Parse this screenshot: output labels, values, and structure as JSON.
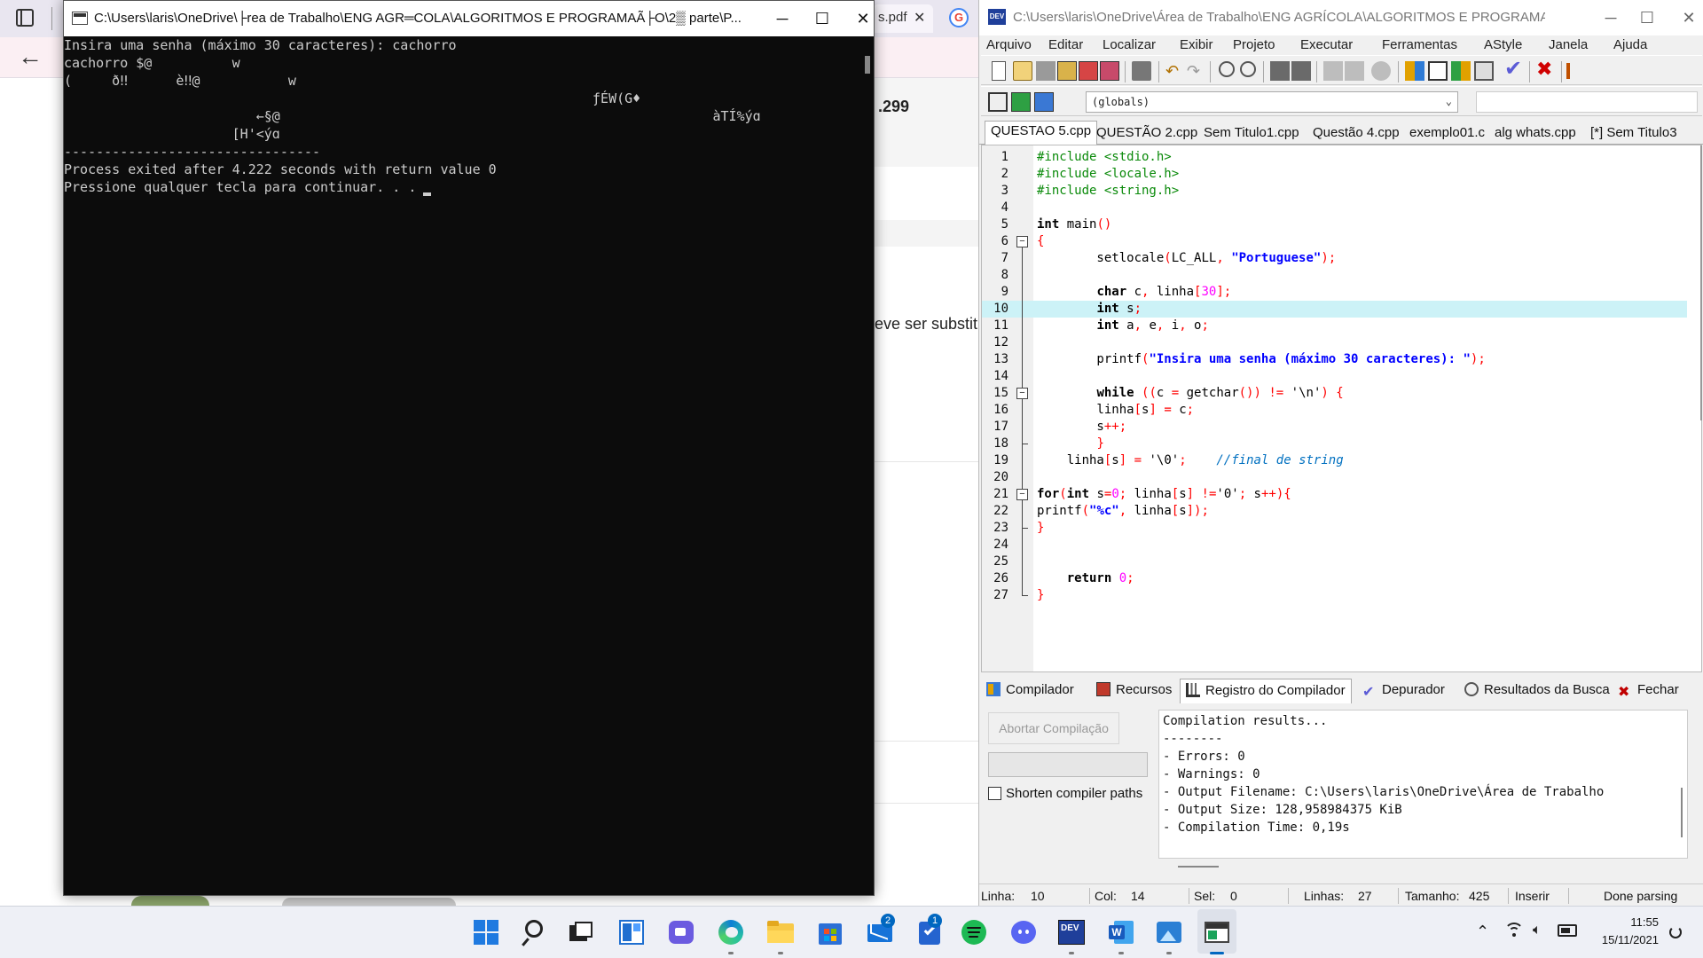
{
  "browser": {
    "tab_label": "s.pdf",
    "tab_close": "✕",
    "google_icon": "G",
    "back_icon": "←",
    "content_number": ".299",
    "content_text": "eve ser substitu"
  },
  "console": {
    "title": "C:\\Users\\laris\\OneDrive\\├rea de Trabalho\\ENG AGR═COLA\\ALGORITMOS E PROGRAMAÃ├O\\2▒ parte\\P...",
    "minimize": "─",
    "maximize": "☐",
    "close": "✕",
    "lines": [
      "Insira uma senha (máximo 30 caracteres): cachorro",
      "cachorro $@          w",
      "(     ð‼      è‼@           w",
      "                                                                  ƒÉW(G♦",
      "                        ←§@                                                      àTÍ%ýɑ",
      "                     [H'<ýɑ",
      "--------------------------------",
      "Process exited after 4.222 seconds with return value 0",
      "Pressione qualquer tecla para continuar. . . "
    ]
  },
  "devcpp": {
    "title": "C:\\Users\\laris\\OneDrive\\Área de Trabalho\\ENG AGRÍCOLA\\ALGORITMOS E PROGRAMAÇ...",
    "logo": "DEV",
    "minimize": "─",
    "maximize": "☐",
    "close": "✕",
    "menu": [
      "Arquivo",
      "Editar",
      "Localizar",
      "Exibir",
      "Projeto",
      "Executar",
      "Ferramentas",
      "AStyle",
      "Janela",
      "Ajuda"
    ],
    "globals": "(globals)",
    "file_tabs": [
      "QUESTAO 5.cpp",
      "QUESTÃO 2.cpp",
      "Sem Titulo1.cpp",
      "Questão 4.cpp",
      "exemplo01.c",
      "alg whats.cpp",
      "[*] Sem Titulo3"
    ],
    "code_lines": [
      "1",
      "2",
      "3",
      "4",
      "5",
      "6",
      "7",
      "8",
      "9",
      "10",
      "11",
      "12",
      "13",
      "14",
      "15",
      "16",
      "17",
      "18",
      "19",
      "20",
      "21",
      "22",
      "23",
      "24",
      "25",
      "26",
      "27"
    ],
    "bottom_tabs": [
      "Compilador",
      "Recursos",
      "Registro do Compilador",
      "Depurador",
      "Resultados da Busca",
      "Fechar"
    ],
    "abort_button": "Abortar Compilação",
    "shorten_label": "Shorten compiler paths",
    "log_lines": [
      "Compilation results...",
      "--------",
      "- Errors: 0",
      "- Warnings: 0",
      "- Output Filename: C:\\Users\\laris\\OneDrive\\Área de Trabalho",
      "- Output Size: 128,958984375 KiB",
      "- Compilation Time: 0,19s"
    ],
    "status": {
      "linha_label": "Linha:",
      "linha": "10",
      "col_label": "Col:",
      "col": "14",
      "sel_label": "Sel:",
      "sel": "0",
      "linhas_label": "Linhas:",
      "linhas": "27",
      "tamanho_label": "Tamanho:",
      "tamanho": "425",
      "mode": "Inserir",
      "parse": "Done parsing"
    }
  },
  "taskbar": {
    "mail_badge": "2",
    "todo_badge": "1",
    "time": "11:55",
    "date": "15/11/2021"
  },
  "colors": {
    "accent": "#0067c0",
    "line_highlight": "#ccf2f7",
    "preprocessor": "#0a8a0a",
    "string": "#0000ff",
    "number": "#ff00ff",
    "symbol": "#ff0000",
    "comment": "#0070c0"
  }
}
